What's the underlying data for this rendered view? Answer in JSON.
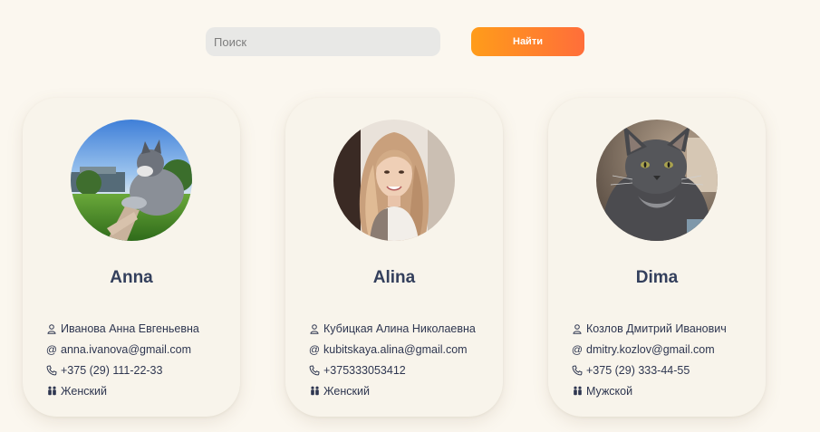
{
  "search": {
    "placeholder": "Поиск",
    "value": "",
    "button_label": "Найти"
  },
  "colors": {
    "background": "#fbf7ef",
    "button_gradient_start": "#ff9c1a",
    "button_gradient_end": "#ff6e3a",
    "card_background": "#f8f4eb",
    "name_text": "#333f5c"
  },
  "cards": [
    {
      "name": "Anna",
      "avatar": "cat-in-grass-photo",
      "full_name": "Иванова Анна Евгеньевна",
      "email": "anna.ivanova@gmail.com",
      "phone": "+375 (29) 111-22-33",
      "gender": "Женский"
    },
    {
      "name": "Alina",
      "avatar": "woman-portrait-photo",
      "full_name": "Кубицкая Алина Николаевна",
      "email": "kubitskaya.alina@gmail.com",
      "phone": "+375333053412",
      "gender": "Женский"
    },
    {
      "name": "Dima",
      "avatar": "grey-cat-photo",
      "full_name": "Козлов Дмитрий Иванович",
      "email": "dmitry.kozlov@gmail.com",
      "phone": "+375 (29) 333-44-55",
      "gender": "Мужской"
    }
  ],
  "icons": {
    "full_name": "user-icon",
    "email": "at-icon",
    "phone": "phone-icon",
    "gender": "gender-icon"
  }
}
